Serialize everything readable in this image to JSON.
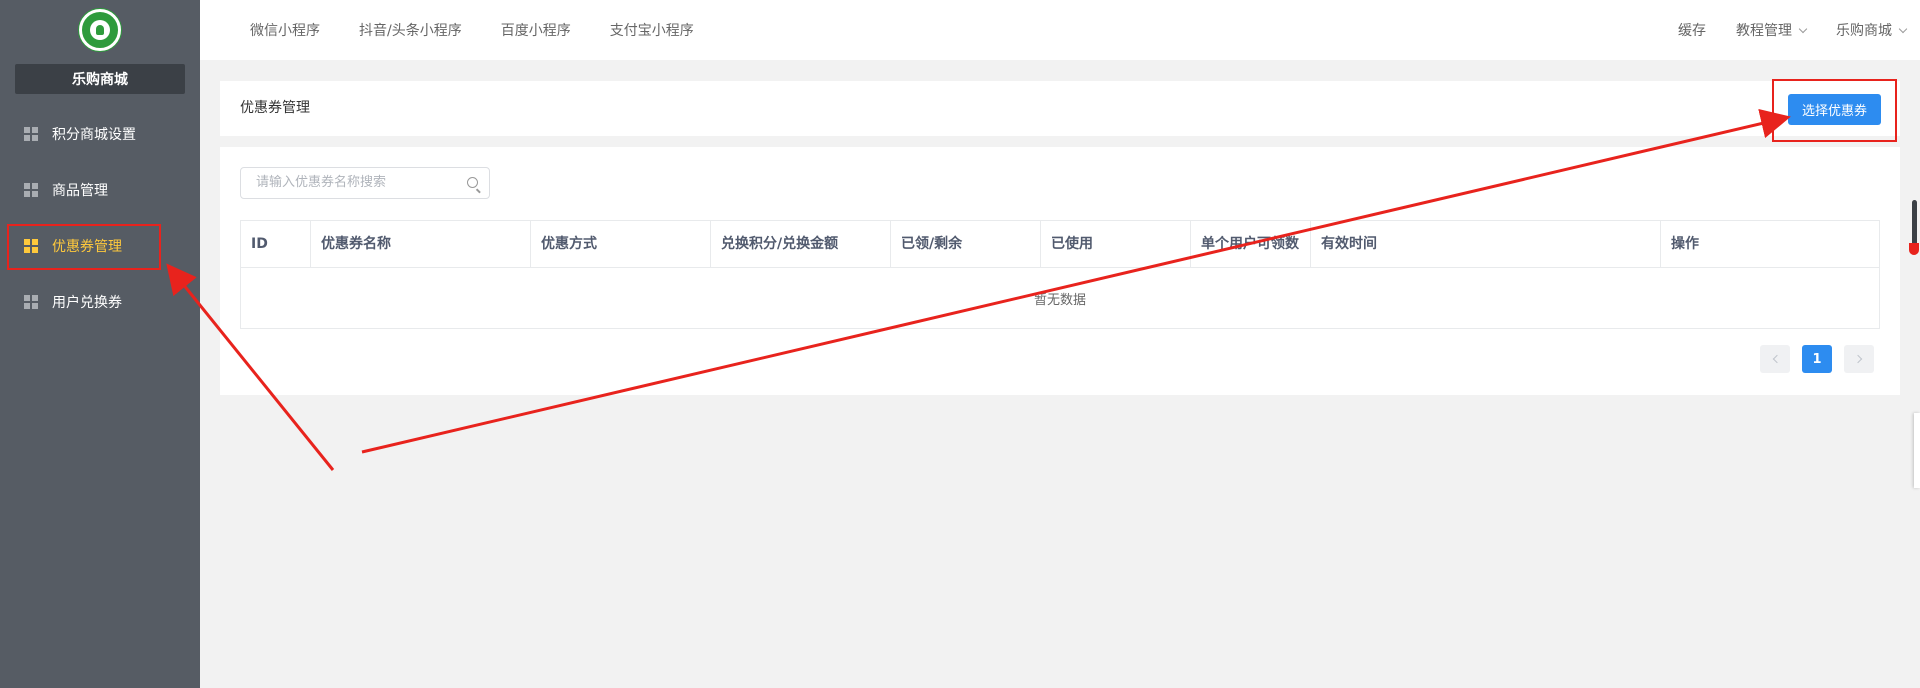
{
  "sidebar": {
    "shop_name": "乐购商城",
    "items": [
      {
        "label": "积分商城设置",
        "icon": "grid-icon",
        "active": false
      },
      {
        "label": "商品管理",
        "icon": "grid-icon",
        "active": false
      },
      {
        "label": "优惠券管理",
        "icon": "grid-icon",
        "active": true
      },
      {
        "label": "用户兑换券",
        "icon": "grid-icon",
        "active": false
      }
    ]
  },
  "topbar": {
    "tabs": [
      "微信小程序",
      "抖音/头条小程序",
      "百度小程序",
      "支付宝小程序"
    ],
    "right": {
      "cache": "缓存",
      "tutorial": "教程管理",
      "shop": "乐购商城"
    }
  },
  "page": {
    "title": "优惠券管理",
    "select_button": "选择优惠券"
  },
  "search": {
    "placeholder": "请输入优惠券名称搜索"
  },
  "table": {
    "columns": [
      "ID",
      "优惠券名称",
      "优惠方式",
      "兑换积分/兑换金额",
      "已领/剩余",
      "已使用",
      "单个用户可领数",
      "有效时间",
      "操作"
    ],
    "empty_text": "暂无数据"
  },
  "pagination": {
    "current": "1"
  },
  "colors": {
    "sidebar": "#565c64",
    "active": "#ffc93c",
    "primary": "#2d8cf0",
    "annotation": "#e8231d"
  }
}
